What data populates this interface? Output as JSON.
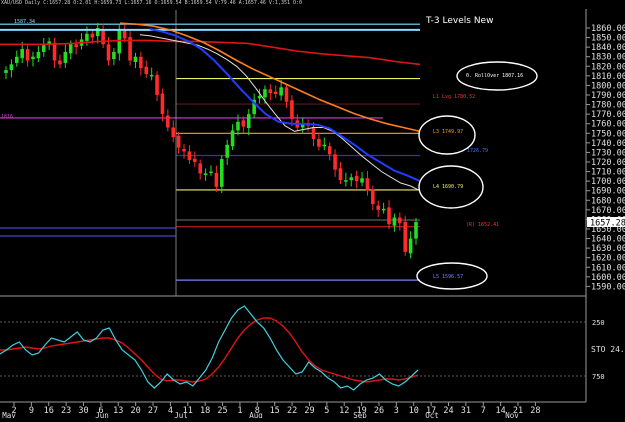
{
  "header": {
    "symbol_line": "XAU/USD Daily  C:1657.28  O:2.01  H:1659.73  L:1657.16  O:1659.54  B:1659.54  V:79.46  A:1657.46  V:1,351  O:0"
  },
  "chart_title": "T-3 Levels New",
  "colors": {
    "background": "#000000",
    "bull_candle": "#22dd22",
    "bear_candle": "#ff2a2a",
    "ma_white": "#e0e0e0",
    "ma_blue": "#1f3cff",
    "ma_orange": "#ff7f1f",
    "ma_red": "#e01414",
    "ma_cyan": "#7fe0ff",
    "level_yellow": "#f0f060",
    "level_magenta": "#d040d0",
    "stoch_k": "#40d0e0",
    "stoch_d": "#e01414"
  },
  "chart_data": {
    "type": "candlestick",
    "symbol": "XAU/USD",
    "timeframe": "Daily",
    "ylim": [
      1584,
      1872
    ],
    "y_ticks": [
      "1860.00",
      "1850.00",
      "1840.00",
      "1830.00",
      "1820.00",
      "1810.00",
      "1800.00",
      "1790.00",
      "1780.00",
      "1770.00",
      "1760.00",
      "1750.00",
      "1740.00",
      "1730.00",
      "1720.00",
      "1710.00",
      "1700.00",
      "1690.00",
      "1680.00",
      "1670.00",
      "1660.00",
      "1650.00",
      "1640.00",
      "1630.00",
      "1620.00",
      "1610.00",
      "1600.00",
      "1590.00"
    ],
    "last_price_label": "1657.28",
    "x_tick_labels": [
      "2",
      "9",
      "16",
      "23",
      "30",
      "6",
      "13",
      "20",
      "27",
      "4",
      "11",
      "18",
      "25",
      "1",
      "8",
      "15",
      "22",
      "29",
      "5",
      "12",
      "19",
      "26",
      "3",
      "10",
      "17",
      "24",
      "31",
      "7",
      "14",
      "21",
      "28"
    ],
    "month_labels": [
      "May",
      "Jun",
      "Jul",
      "Aug",
      "Sep",
      "Oct",
      "Nov"
    ],
    "closes": [
      1816,
      1822,
      1830,
      1838,
      1826,
      1830,
      1835,
      1842,
      1846,
      1826,
      1822,
      1835,
      1843,
      1840,
      1848,
      1854,
      1850,
      1860,
      1843,
      1826,
      1835,
      1858,
      1849,
      1826,
      1830,
      1818,
      1812,
      1811,
      1790,
      1770,
      1756,
      1746,
      1735,
      1731,
      1722,
      1720,
      1708,
      1708,
      1710,
      1694,
      1723,
      1738,
      1753,
      1762,
      1757,
      1770,
      1785,
      1789,
      1796,
      1792,
      1791,
      1798,
      1783,
      1765,
      1756,
      1759,
      1758,
      1744,
      1736,
      1738,
      1728,
      1712,
      1701,
      1701,
      1704,
      1700,
      1703,
      1690,
      1676,
      1670,
      1671,
      1655,
      1662,
      1656,
      1626,
      1640,
      1657.28
    ],
    "ma_white": [
      1853,
      1852,
      1850,
      1848,
      1846,
      1844,
      1842,
      1838,
      1833,
      1827,
      1820,
      1810,
      1797,
      1783,
      1770,
      1758,
      1752,
      1754,
      1756,
      1756,
      1752,
      1744,
      1735,
      1726,
      1718,
      1710,
      1704,
      1698,
      1695,
      1690
    ],
    "ma_blue": [
      1859,
      1856,
      1852,
      1846,
      1838,
      1826,
      1812,
      1797,
      1783,
      1770,
      1762,
      1760,
      1760,
      1759,
      1755,
      1746,
      1737,
      1727,
      1719,
      1711,
      1706,
      1700
    ],
    "ma_orange": [
      1865,
      1864,
      1862,
      1858,
      1852,
      1845,
      1836,
      1826,
      1817,
      1809,
      1801,
      1793,
      1785,
      1778,
      1771,
      1765,
      1760,
      1756,
      1752
    ],
    "ma_red": [
      1843,
      1843,
      1843,
      1844,
      1846,
      1847,
      1847,
      1846,
      1846,
      1845,
      1844,
      1840,
      1836,
      1833,
      1831,
      1829,
      1825,
      1822
    ],
    "ma_cyan": [
      1858,
      1858,
      1858,
      1858,
      1858
    ],
    "levels": [
      {
        "label": "0. RollOver 1807.16",
        "price": 1807.16
      },
      {
        "label": "L1 Lvg 1780.52",
        "price": 1780.52
      },
      {
        "label": "1816",
        "price": 1766
      },
      {
        "label": "L3 1749.97",
        "price": 1749.97
      },
      {
        "label": "1726.79",
        "price": 1726.79
      },
      {
        "label": "L4 1690.79",
        "price": 1690.79
      },
      {
        "label": "(R) 1652.41",
        "price": 1652.41
      },
      {
        "label": "L5 1596.57",
        "price": 1596.57
      },
      {
        "label": "1587.34",
        "price": 1864
      }
    ],
    "stochastic": {
      "label": "STO 24.",
      "levels": [
        "250",
        "750"
      ],
      "k": [
        46,
        50,
        55,
        58,
        50,
        45,
        47,
        55,
        62,
        60,
        58,
        63,
        68,
        60,
        58,
        62,
        70,
        72,
        60,
        50,
        45,
        40,
        30,
        18,
        12,
        18,
        26,
        20,
        16,
        18,
        14,
        22,
        30,
        42,
        58,
        70,
        82,
        90,
        94,
        86,
        78,
        72,
        62,
        50,
        40,
        33,
        26,
        28,
        38,
        32,
        28,
        22,
        18,
        12,
        14,
        10,
        16,
        20,
        22,
        26,
        20,
        16,
        14,
        18,
        24,
        30
      ],
      "d": [
        50,
        50,
        51,
        52,
        53,
        52,
        51,
        52,
        54,
        55,
        56,
        57,
        58,
        59,
        60,
        61,
        62,
        62,
        60,
        57,
        52,
        46,
        40,
        33,
        26,
        21,
        19,
        20,
        20,
        19,
        18,
        19,
        21,
        26,
        33,
        42,
        52,
        62,
        70,
        76,
        80,
        82,
        82,
        79,
        74,
        67,
        58,
        48,
        40,
        34,
        30,
        28,
        26,
        24,
        22,
        20,
        19,
        18,
        19,
        20,
        21,
        21,
        20,
        21,
        23,
        25
      ],
      "ylim": [
        0,
        100
      ]
    }
  }
}
